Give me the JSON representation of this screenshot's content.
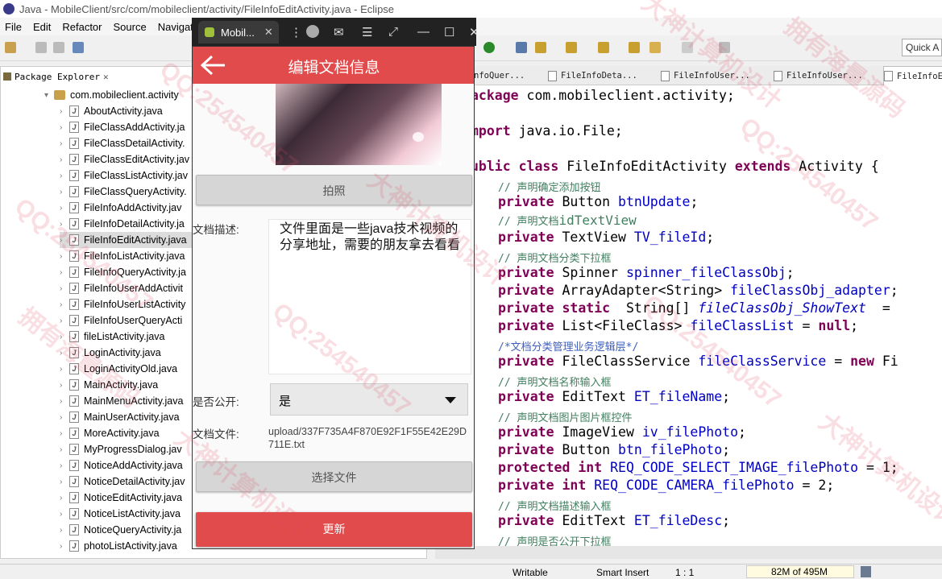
{
  "window": {
    "title": "Java - MobileClient/src/com/mobileclient/activity/FileInfoEditActivity.java - Eclipse"
  },
  "menu": [
    "File",
    "Edit",
    "Refactor",
    "Source",
    "Navigat"
  ],
  "quick_access": "Quick A",
  "package_explorer": {
    "tab_label": "Package Explorer",
    "package": "com.mobileclient.activity",
    "files": [
      "AboutActivity.java",
      "FileClassAddActivity.ja",
      "FileClassDetailActivity.",
      "FileClassEditActivity.jav",
      "FileClassListActivity.jav",
      "FileClassQueryActivity.",
      "FileInfoAddActivity.jav",
      "FileInfoDetailActivity.ja",
      "FileInfoEditActivity.java",
      "FileInfoListActivity.java",
      "FileInfoQueryActivity.ja",
      "FileInfoUserAddActivit",
      "FileInfoUserListActivity",
      "FileInfoUserQueryActi",
      "fileListActivity.java",
      "LoginActivity.java",
      "LoginActivityOld.java",
      "MainActivity.java",
      "MainMenuActivity.java",
      "MainUserActivity.java",
      "MoreActivity.java",
      "MyProgressDialog.jav",
      "NoticeAddActivity.java",
      "NoticeDetailActivity.jav",
      "NoticeEditActivity.java",
      "NoticeListActivity.java",
      "NoticeQueryActivity.ja",
      "photoListActivity.java"
    ],
    "selected_index": 8
  },
  "editor": {
    "tabs": [
      "nfoQuer...",
      "FileInfoDeta...",
      "FileInfoUser...",
      "FileInfoUser...",
      "FileInfoE"
    ],
    "code": {
      "l1a": "ackage",
      "l1b": " com.mobileclient.activity;",
      "l2a": "mport",
      "l2b": " java.io.File;",
      "l3a": "ublic class",
      "l3b": " FileInfoEditActivity ",
      "l3c": "extends",
      "l3d": " Activity {",
      "c1": "// 声明确定添加按钮",
      "l4a": "private",
      "l4b": " Button ",
      "l4c": "btnUpdate",
      "l4d": ";",
      "c2a": "// 声明文档",
      "c2b": "idTextView",
      "l5a": "private",
      "l5b": " TextView ",
      "l5c": "TV_fileId",
      "l5d": ";",
      "c3": "// 声明文档分类下拉框",
      "l6a": "private",
      "l6b": " Spinner ",
      "l6c": "spinner_fileClassObj",
      "l6d": ";",
      "l7a": "private",
      "l7b": " ArrayAdapter<String> ",
      "l7c": "fileClassObj_adapter",
      "l7d": ";",
      "l8a": "private static",
      "l8b": "  String[] ",
      "l8c": "fileClassObj_ShowText",
      "l8d": "  =",
      "l9a": "private",
      "l9b": " List<FileClass> ",
      "l9c": "fileClassList",
      "l9d": " = ",
      "l9e": "null",
      "l9f": ";",
      "c4": "/*文档分类管理业务逻辑层*/",
      "l10a": "private",
      "l10b": " FileClassService ",
      "l10c": "fileClassService",
      "l10d": " = ",
      "l10e": "new",
      "l10f": " Fi",
      "c5": "// 声明文档名称输入框",
      "l11a": "private",
      "l11b": " EditText ",
      "l11c": "ET_fileName",
      "l11d": ";",
      "c6": "// 声明文档图片图片框控件",
      "l12a": "private",
      "l12b": " ImageView ",
      "l12c": "iv_filePhoto",
      "l12d": ";",
      "l13a": "private",
      "l13b": " Button ",
      "l13c": "btn_filePhoto",
      "l13d": ";",
      "l14a": "protected int",
      "l14b": " ",
      "l14c": "REQ_CODE_SELECT_IMAGE_filePhoto",
      "l14d": " = 1;",
      "l15a": "private int",
      "l15b": " ",
      "l15c": "REQ_CODE_CAMERA_filePhoto",
      "l15d": " = 2;",
      "c7": "// 声明文档描述输入框",
      "l16a": "private",
      "l16b": " EditText ",
      "l16c": "ET_fileDesc",
      "l16d": ";",
      "c8": "// 声明是否公开下拉框"
    }
  },
  "status": {
    "writable": "Writable",
    "insert_mode": "Smart Insert",
    "position": "1 : 1",
    "memory": "82M of 495M"
  },
  "emulator": {
    "tab_label": "Mobil...",
    "app_title": "编辑文档信息",
    "photo_button": "拍照",
    "desc_label": "文档描述:",
    "desc_value": "文件里面是一些java技术视频的分享地址，需要的朋友拿去看看",
    "public_label": "是否公开:",
    "public_value": "是",
    "file_label": "文档文件:",
    "file_value": "upload/337F735A4F870E92F1F55E42E29D711E.txt",
    "choose_file_button": "选择文件",
    "update_button": "更新"
  },
  "watermark": {
    "qq": "QQ:254540457",
    "slogan": "大神计算机设计",
    "slogan2": "拥有海量源码"
  }
}
